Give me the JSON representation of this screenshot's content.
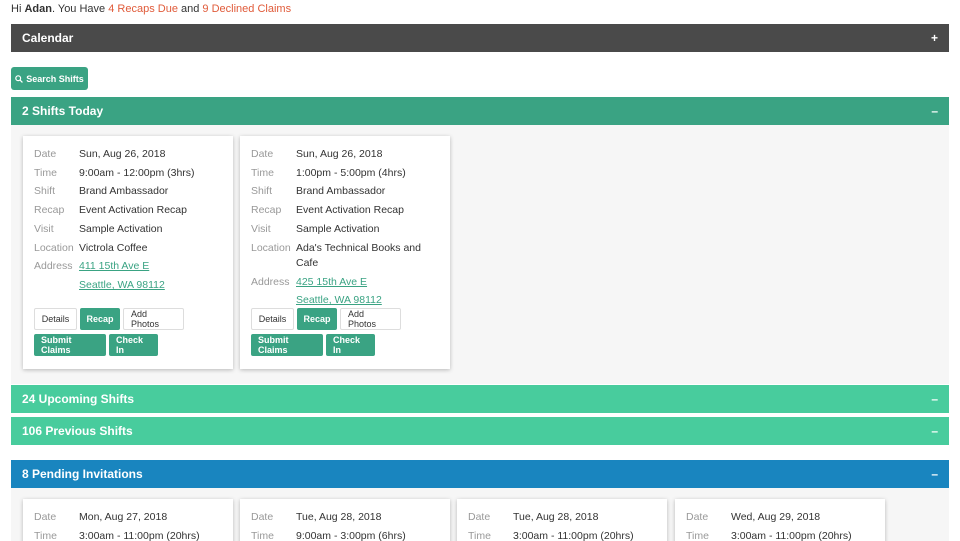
{
  "greeting": {
    "hi": "Hi ",
    "name": "Adan",
    "mid": ". You Have ",
    "recaps": "4 Recaps Due",
    "and": " and ",
    "claims": "9 Declined Claims"
  },
  "calendar": {
    "title": "Calendar",
    "toggle": "+"
  },
  "search": {
    "label": "Search Shifts"
  },
  "today": {
    "title": "2 Shifts Today",
    "toggle": "–",
    "labels": {
      "date": "Date",
      "time": "Time",
      "shift": "Shift",
      "recap": "Recap",
      "visit": "Visit",
      "location": "Location",
      "address": "Address"
    },
    "buttons": {
      "details": "Details",
      "recap": "Recap",
      "add_photos": "Add Photos",
      "submit_claims": "Submit Claims",
      "check_in": "Check In"
    },
    "cards": [
      {
        "date": "Sun, Aug 26, 2018",
        "time": "9:00am - 12:00pm (3hrs)",
        "shift": "Brand Ambassador",
        "recap": "Event Activation Recap",
        "visit": "Sample Activation",
        "location": "Victrola Coffee",
        "address1": "411 15th Ave E",
        "address2": "Seattle, WA 98112"
      },
      {
        "date": "Sun, Aug 26, 2018",
        "time": "1:00pm - 5:00pm (4hrs)",
        "shift": "Brand Ambassador",
        "recap": "Event Activation Recap",
        "visit": "Sample Activation",
        "location1": "Ada's Technical Books and",
        "location2": "Cafe",
        "address1": "425 15th Ave E",
        "address2": "Seattle, WA 98112"
      }
    ]
  },
  "upcoming": {
    "title": "24 Upcoming Shifts",
    "toggle": "–"
  },
  "previous": {
    "title": "106 Previous Shifts",
    "toggle": "–"
  },
  "pending": {
    "title": "8 Pending Invitations",
    "toggle": "–",
    "cards": [
      {
        "date": "Mon, Aug 27, 2018",
        "time": "3:00am - 11:00pm (20hrs)"
      },
      {
        "date": "Tue, Aug 28, 2018",
        "time": "9:00am - 3:00pm (6hrs)"
      },
      {
        "date": "Tue, Aug 28, 2018",
        "time": "3:00am - 11:00pm (20hrs)"
      },
      {
        "date": "Wed, Aug 29, 2018",
        "time": "3:00am - 11:00pm (20hrs)"
      }
    ]
  },
  "colors": {
    "primary_green": "#3aa383",
    "light_green": "#48cc9d",
    "blue": "#1985bf",
    "dark": "#4a4a4a",
    "warning": "#e05b3a"
  },
  "icons": {
    "search": "search-icon"
  }
}
